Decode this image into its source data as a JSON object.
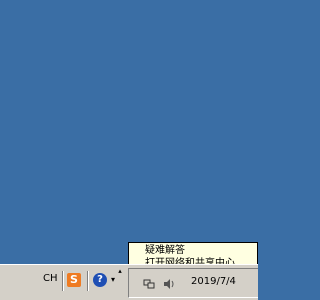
{
  "taskbar": {
    "language": "CH",
    "ime_icon_letter": "S",
    "help_icon_glyph": "?",
    "tray_toggle_glyph": "▴",
    "clock": "2019/7/4"
  },
  "tooltip": {
    "lines": [
      "疑难解答",
      "打开网络和共享中心"
    ]
  },
  "colors": {
    "desktop": "#3a6ea5",
    "taskbar": "#d4d0c8",
    "ime": "#ef7b22",
    "help": "#1f4fb4",
    "tooltip_bg": "#ffffe1"
  },
  "icons": {
    "ime": "sogou-ime-icon",
    "help": "help-icon",
    "network": "network-icon",
    "volume": "volume-icon"
  }
}
